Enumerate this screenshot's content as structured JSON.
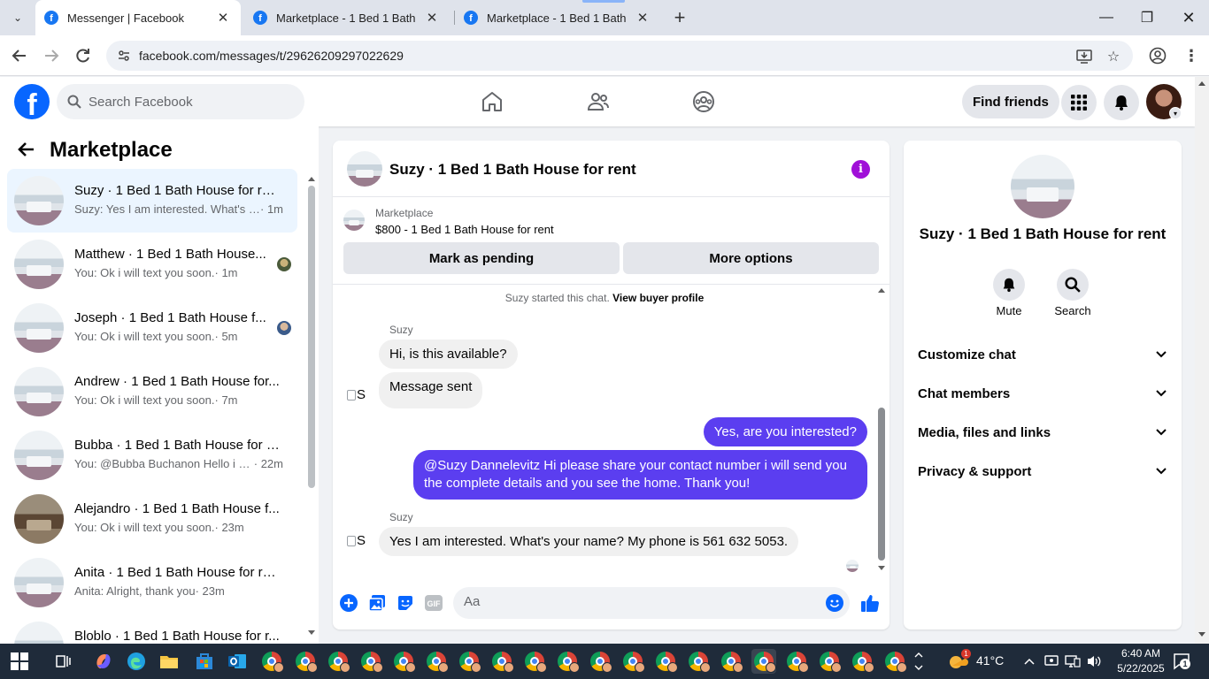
{
  "browser": {
    "tabs": [
      {
        "title": "Messenger | Facebook",
        "active": true
      },
      {
        "title": "Marketplace - 1 Bed 1 Bath Hou",
        "active": false
      },
      {
        "title": "Marketplace - 1 Bed 1 Bath Hou",
        "active": false
      }
    ],
    "url": "facebook.com/messages/t/29626209297022629"
  },
  "fb_header": {
    "logo": "f",
    "search_placeholder": "Search Facebook",
    "find_friends": "Find friends"
  },
  "sidebar": {
    "title": "Marketplace",
    "conversations": [
      {
        "name": "Suzy · 1 Bed 1 Bath House for rent",
        "preview": "Suzy: Yes I am interested. What's y...",
        "time": " · 1m",
        "active": true,
        "thumb": "light",
        "mini_avatar": false
      },
      {
        "name": "Matthew · 1 Bed 1 Bath House...",
        "preview": "You: Ok i will text you soon.",
        "time": " · 1m",
        "active": false,
        "thumb": "light",
        "mini_avatar": true
      },
      {
        "name": "Joseph · 1 Bed 1 Bath House f...",
        "preview": "You: Ok i will text you soon.",
        "time": " · 5m",
        "active": false,
        "thumb": "light",
        "mini_avatar": true
      },
      {
        "name": "Andrew · 1 Bed 1 Bath House for...",
        "preview": "You: Ok i will text you soon.",
        "time": " · 7m",
        "active": false,
        "thumb": "light",
        "mini_avatar": false
      },
      {
        "name": "Bubba · 1 Bed 1 Bath House for r...",
        "preview": "You: @Bubba Buchanon Hello i a...",
        "time": " · 22m",
        "active": false,
        "thumb": "light",
        "mini_avatar": false
      },
      {
        "name": "Alejandro · 1 Bed 1 Bath House f...",
        "preview": "You: Ok i will text you soon.",
        "time": " · 23m",
        "active": false,
        "thumb": "dark",
        "mini_avatar": false
      },
      {
        "name": "Anita · 1 Bed 1 Bath House for rent",
        "preview": "Anita: Alright, thank you",
        "time": " · 23m",
        "active": false,
        "thumb": "light",
        "mini_avatar": false
      },
      {
        "name": "Bloblo · 1 Bed 1 Bath House for r...",
        "preview": "",
        "time": "",
        "active": false,
        "thumb": "light",
        "mini_avatar": false
      }
    ]
  },
  "chat": {
    "title": "Suzy · 1 Bed 1 Bath House for rent",
    "listing_label": "Marketplace",
    "listing_price": "$800 - 1 Bed 1 Bath House for rent",
    "mark_pending": "Mark as pending",
    "more_options": "More options",
    "started_prefix": "Suzy started this chat.",
    "view_buyer_profile": "View buyer profile",
    "sender_name": "Suzy",
    "avatar_alt": "S",
    "messages": {
      "in1": "Hi, is this available?",
      "in2": "Message sent",
      "out1": "Yes, are you interested?",
      "out2": "@Suzy Dannelevitz Hi please share your contact number i will send you the complete details and you see the home. Thank you!",
      "in3": "Yes I am interested. What's your name? My phone is 561 632 5053."
    },
    "composer_placeholder": "Aa",
    "gif_label": "GIF"
  },
  "right_panel": {
    "name": "Suzy · 1 Bed 1 Bath House for rent",
    "mute": "Mute",
    "search": "Search",
    "sections": [
      "Customize chat",
      "Chat members",
      "Media, files and links",
      "Privacy & support"
    ]
  },
  "taskbar": {
    "weather": "41°C",
    "weather_badge": "1",
    "time": "6:40 AM",
    "date": "5/22/2025",
    "notification_count": "1"
  },
  "colors": {
    "fb_blue": "#0866ff",
    "messenger_purple": "#5b3ef0",
    "info_purple": "#a010d8"
  }
}
